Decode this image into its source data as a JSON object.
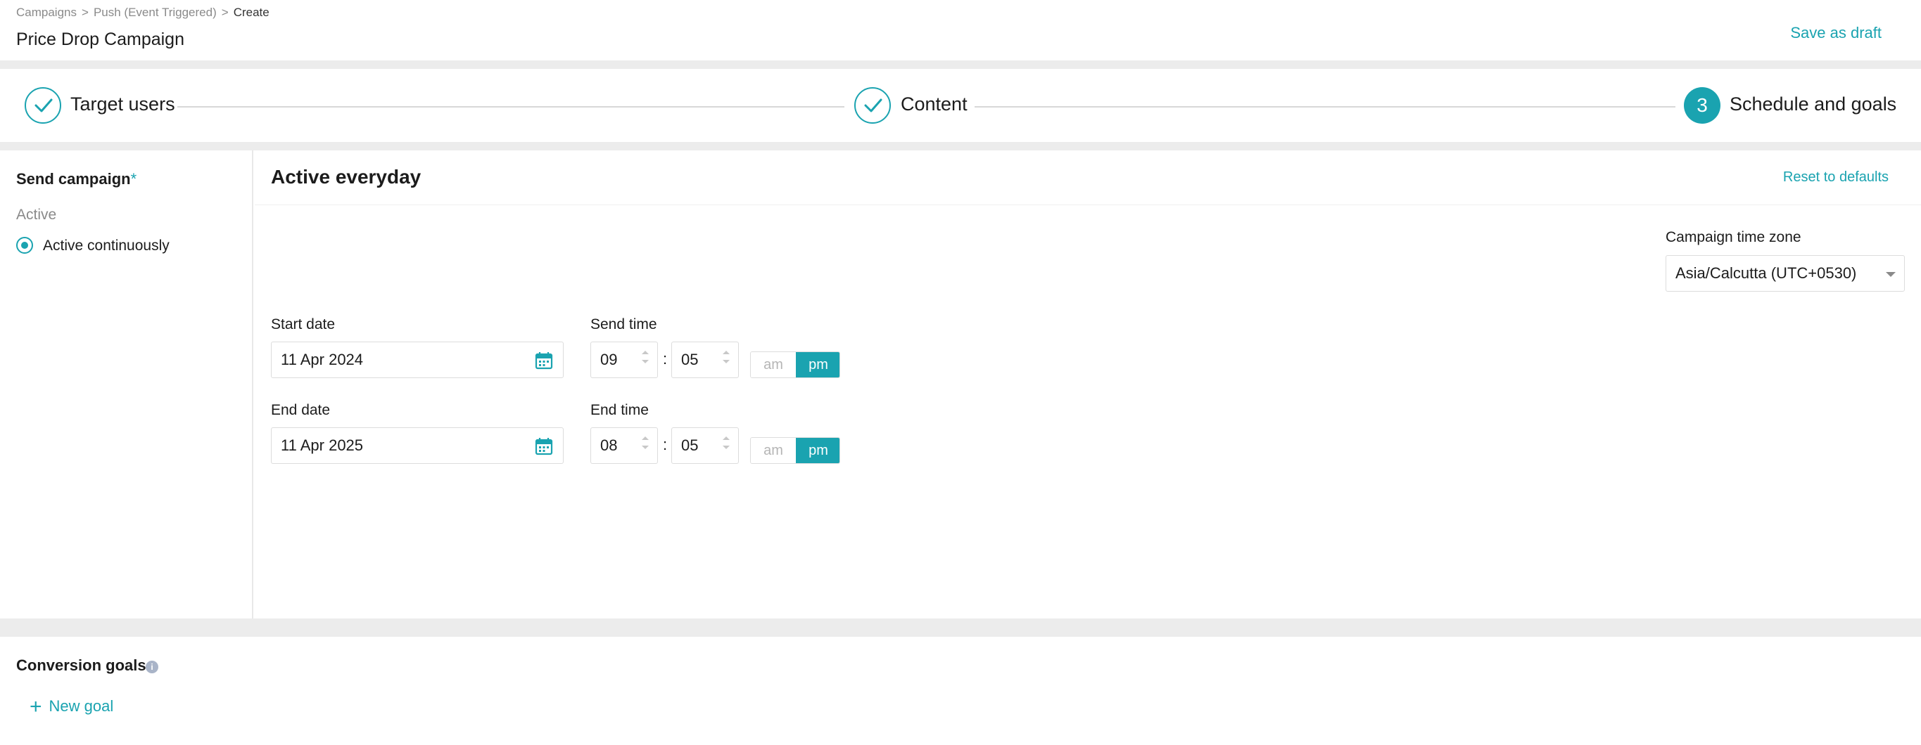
{
  "header": {
    "breadcrumb": [
      "Campaigns",
      "Push (Event Triggered)",
      "Create"
    ],
    "breadcrumb_seps": [
      ">",
      ">"
    ],
    "title": "Price Drop Campaign",
    "save_draft": "Save as draft"
  },
  "stepper": {
    "steps": [
      {
        "label": "Target users",
        "status": "done",
        "icon": "check-icon"
      },
      {
        "label": "Content",
        "status": "done",
        "icon": "check-icon"
      },
      {
        "label": "Schedule and goals",
        "status": "active",
        "number": "3"
      }
    ]
  },
  "send_campaign": {
    "title": "Send campaign",
    "required_mark": "*",
    "group_label": "Active",
    "option": "Active continuously",
    "option_selected": true
  },
  "schedule": {
    "section_title": "Active everyday",
    "reset_label": "Reset to defaults",
    "timezone": {
      "label": "Campaign time zone",
      "value": "Asia/Calcutta (UTC+0530)"
    },
    "start_date": {
      "label": "Start date",
      "value": "11 Apr 2024"
    },
    "send_time": {
      "label": "Send time",
      "hour": "09",
      "minute": "05",
      "am": "am",
      "pm": "pm",
      "selected": "pm"
    },
    "end_date": {
      "label": "End date",
      "value": "11 Apr 2025"
    },
    "end_time": {
      "label": "End time",
      "hour": "08",
      "minute": "05",
      "am": "am",
      "pm": "pm",
      "selected": "pm"
    },
    "time_separator": ":"
  },
  "goals": {
    "title": "Conversion goals",
    "info_icon": "i",
    "new_goal": "New goal",
    "plus": "+"
  },
  "colors": {
    "accent": "#1aa3b0",
    "muted": "#8a8a8a",
    "border": "#dcdcdc"
  }
}
